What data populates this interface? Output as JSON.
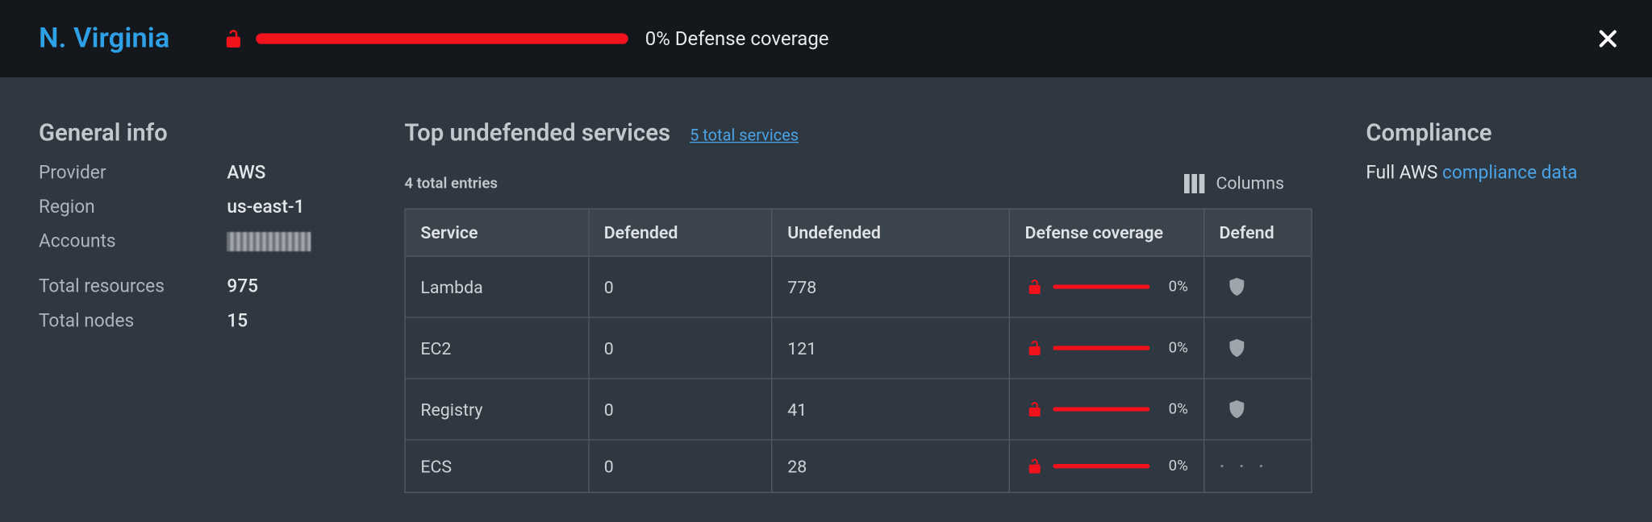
{
  "header": {
    "region_title": "N. Virginia",
    "coverage_pct_text": "0% Defense coverage",
    "coverage_pct": 0
  },
  "general": {
    "title": "General info",
    "rows": [
      {
        "key": "Provider",
        "val": "AWS"
      },
      {
        "key": "Region",
        "val": "us-east-1"
      },
      {
        "key": "Accounts",
        "val": "",
        "redacted": true
      }
    ],
    "rows2": [
      {
        "key": "Total resources",
        "val": "975"
      },
      {
        "key": "Total nodes",
        "val": "15"
      }
    ]
  },
  "mid": {
    "title": "Top undefended services",
    "link": "5 total services",
    "total_entries": "4 total entries",
    "columns_label": "Columns",
    "headers": {
      "service": "Service",
      "defended": "Defended",
      "undefended": "Undefended",
      "coverage": "Defense coverage",
      "defend": "Defend"
    },
    "rows": [
      {
        "service": "Lambda",
        "defended": "0",
        "undefended": "778",
        "pct": "0%",
        "defend": "shield"
      },
      {
        "service": "EC2",
        "defended": "0",
        "undefended": "121",
        "pct": "0%",
        "defend": "shield"
      },
      {
        "service": "Registry",
        "defended": "0",
        "undefended": "41",
        "pct": "0%",
        "defend": "shield"
      },
      {
        "service": "ECS",
        "defended": "0",
        "undefended": "28",
        "pct": "0%",
        "defend": "dots"
      }
    ]
  },
  "compliance": {
    "title": "Compliance",
    "prefix": "Full AWS ",
    "link": "compliance data"
  },
  "colors": {
    "accent_blue": "#2ea0e6",
    "danger_red": "#f2121c",
    "panel_bg": "#2f3740",
    "topbar_bg": "#14171b"
  },
  "chart_data": {
    "type": "table",
    "title": "Top undefended services",
    "columns": [
      "Service",
      "Defended",
      "Undefended",
      "Defense coverage %"
    ],
    "rows": [
      [
        "Lambda",
        0,
        778,
        0
      ],
      [
        "EC2",
        0,
        121,
        0
      ],
      [
        "Registry",
        0,
        41,
        0
      ],
      [
        "ECS",
        0,
        28,
        0
      ]
    ],
    "overall_defense_coverage_pct": 0
  }
}
